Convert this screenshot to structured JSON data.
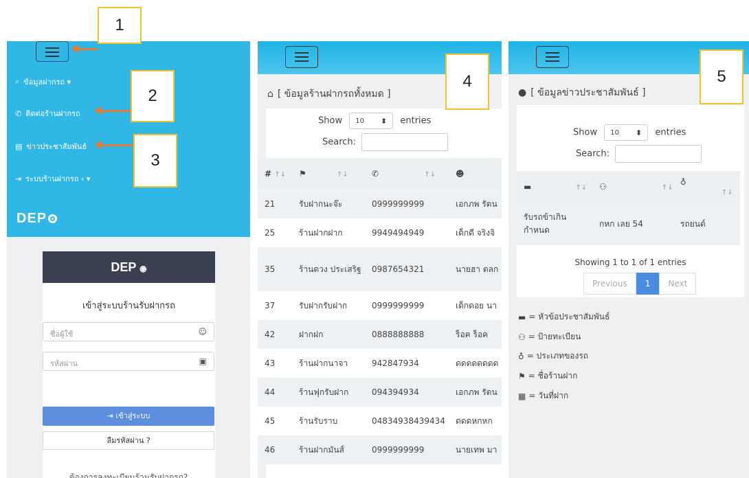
{
  "callouts": [
    "1",
    "2",
    "3",
    "4",
    "5"
  ],
  "sidebar": {
    "items": [
      {
        "icon": "search-icon",
        "label": "ข้อมูลฝากรถ ▾"
      },
      {
        "icon": "phone-icon",
        "label": "ติดต่อร้านฝากรถ"
      },
      {
        "icon": "message-icon",
        "label": "ข่าวประชาสัมพันธ์"
      },
      {
        "icon": "sign-in-icon",
        "label": "ระบบร้านฝากรถ ‹ ▾"
      }
    ],
    "logo": "DEP"
  },
  "login": {
    "brand": "DEP",
    "title": "เข้าสู่ระบบร้านรับฝากรถ",
    "username_placeholder": "ชื่อผู้ใช้",
    "password_placeholder": "รหัสผ่าน",
    "login_button": "เข้าสู่ระบบ",
    "forgot_button": "ลืมรหัสผ่าน ?",
    "register_text": "ต้องการลงทะเบียนร้านรับฝากรถ?"
  },
  "shops": {
    "title": "[ ข้อมูลร้านฝากรถทั้งหมด ]",
    "show_label": "Show",
    "entries_value": "10",
    "entries_label": "entries",
    "search_label": "Search:",
    "headers": [
      "#",
      ""
    ],
    "rows": [
      [
        "21",
        "รับฝากนะจ๊ะ",
        "0999999999",
        "เอกภพ รัตน"
      ],
      [
        "25",
        "ร้านฝากฝาก",
        "9949494949",
        "เด็กดี จริงจิ"
      ],
      [
        "35",
        "ร้านดวง ประเสริฐ",
        "0987654321",
        "นายฮา ตลก"
      ],
      [
        "37",
        "รับฝากรับฝาก",
        "0999999999",
        "เด็กดอย นา"
      ],
      [
        "42",
        "ฝากฝก",
        "0888888888",
        "ร็อค ร็อค"
      ],
      [
        "43",
        "ร้านฝากนาจา",
        "942847934",
        "ดดดดดดดด"
      ],
      [
        "44",
        "ร้านฟุกรับฝาก",
        "094394934",
        "เอกภพ รัตน"
      ],
      [
        "45",
        "ร้านรับราบ",
        "04834938439434",
        "ดดดหกหก"
      ],
      [
        "46",
        "ร้านฝากมันส์",
        "0999999999",
        "นายเทพ มา"
      ]
    ]
  },
  "news": {
    "title": "[ ข้อมูลข่าวประชาสัมพันธ์ ]",
    "show_label": "Show",
    "entries_value": "10",
    "entries_label": "entries",
    "search_label": "Search:",
    "rows": [
      [
        "รับรถข้าเกิน กำหนด",
        "กหก เลย 54",
        "รถยนต์"
      ]
    ],
    "info": "Showing 1 to 1 of 1 entries",
    "pager": [
      "Previous",
      "1",
      "Next"
    ],
    "legend": [
      {
        "icon": "comment-icon",
        "text": "= หัวข้อประชาสัมพันธ์"
      },
      {
        "icon": "car-icon",
        "text": "= ป้ายทะเบียน"
      },
      {
        "icon": "motorcycle-icon",
        "text": "= ประเภทของรถ"
      },
      {
        "icon": "flag-icon",
        "text": "= ชื่อร้านฝาก"
      },
      {
        "icon": "calendar-icon",
        "text": "= วันที่ฝาก"
      }
    ]
  },
  "colors": {
    "header": "#31b7e6",
    "accent": "#e57b34",
    "callout_border": "#f2c12e",
    "primary": "#5b8fdd"
  }
}
